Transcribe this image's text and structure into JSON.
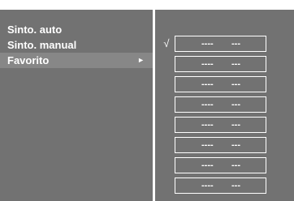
{
  "menu": {
    "items": [
      {
        "label": "Sinto. auto"
      },
      {
        "label": "Sinto. manual"
      },
      {
        "label": "Favorito",
        "arrow": "►"
      }
    ]
  },
  "favorites": {
    "check_mark": "√",
    "slots": [
      {
        "a": "----",
        "b": "---",
        "checked": true
      },
      {
        "a": "----",
        "b": "---"
      },
      {
        "a": "----",
        "b": "---"
      },
      {
        "a": "----",
        "b": "---"
      },
      {
        "a": "----",
        "b": "---"
      },
      {
        "a": "----",
        "b": "---"
      },
      {
        "a": "----",
        "b": "---"
      },
      {
        "a": "----",
        "b": "---"
      }
    ]
  }
}
